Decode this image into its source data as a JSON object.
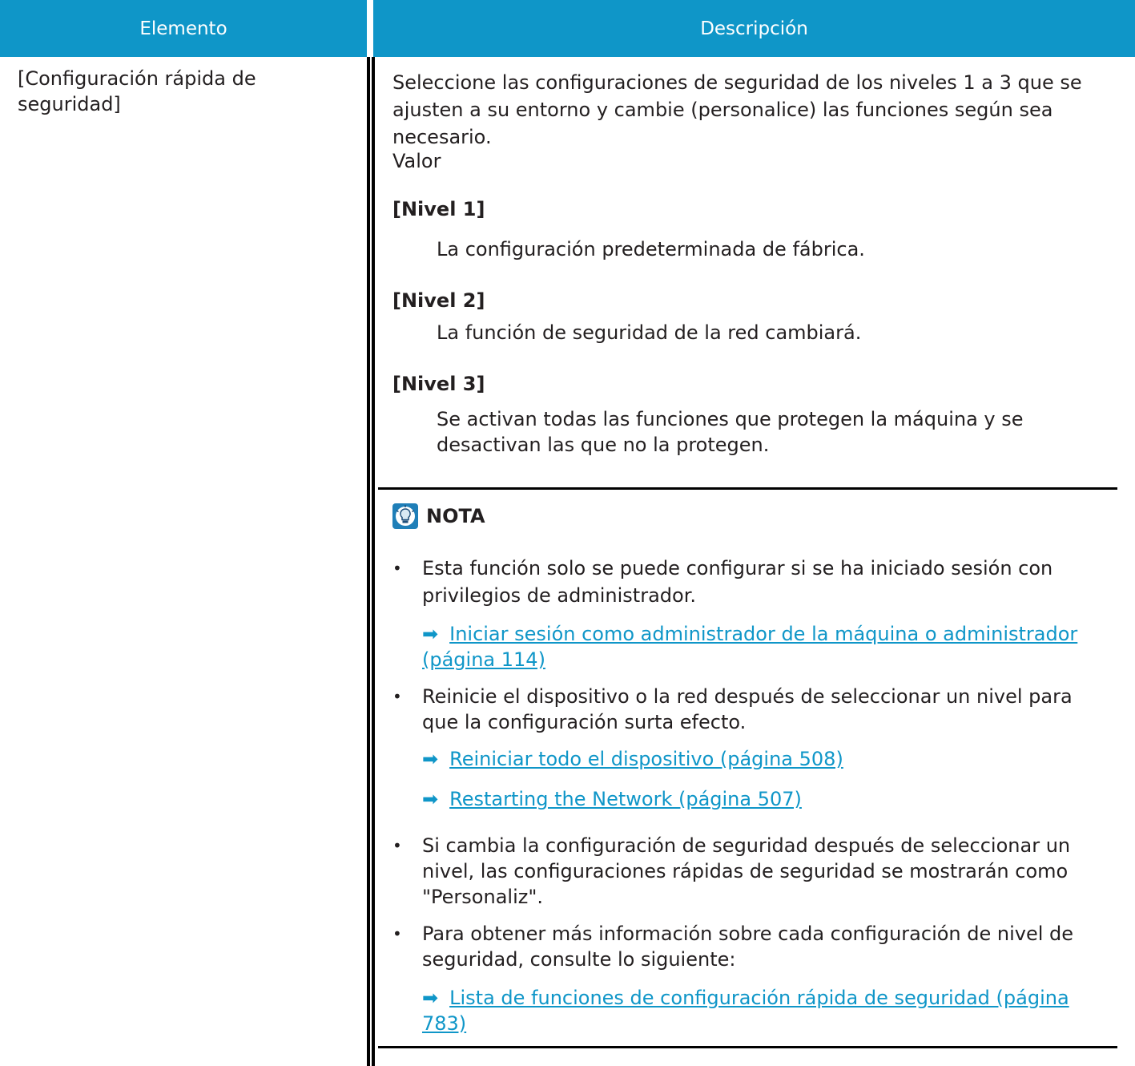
{
  "header": {
    "col1": "Elemento",
    "col2": "Descripción"
  },
  "item": {
    "line1": "[Configuración rápida de",
    "line2": "seguridad]"
  },
  "description": {
    "intro1": "Seleccione las configuraciones de seguridad de los niveles 1 a 3 que se",
    "intro2": "ajusten a su entorno y cambie (personalice) las funciones según sea",
    "intro3": "necesario.",
    "value_label": "Valor",
    "levels": [
      {
        "name": "[Nivel 1]",
        "desc1": "La configuración predeterminada de fábrica."
      },
      {
        "name": "[Nivel 2]",
        "desc1": "La función de seguridad de la red cambiará."
      },
      {
        "name": "[Nivel 3]",
        "desc1": "Se activan todas las funciones que protegen la máquina y se",
        "desc2": "desactivan las que no la protegen."
      }
    ]
  },
  "note": {
    "title": "NOTA",
    "icon": "lightbulb-icon",
    "bullets": [
      {
        "line1": "Esta función solo se puede configurar si se ha iniciado sesión con",
        "line2": "privilegios de administrador."
      },
      {
        "line1": "Reinicie el dispositivo o la red después de seleccionar un nivel para",
        "line2": "que la configuración surta efecto."
      },
      {
        "line1": "Si cambia la configuración de seguridad después de seleccionar un",
        "line2": "nivel, las configuraciones rápidas de seguridad se mostrarán como",
        "line3": "\"Personaliz\"."
      },
      {
        "line1": "Para obtener más información sobre cada configuración de nivel de",
        "line2": "seguridad, consulte lo siguiente:"
      }
    ],
    "links": {
      "admin_login1": "Iniciar sesión como administrador de la máquina o administrador",
      "admin_login2": "(página 114)",
      "restart_device": "Reiniciar todo el dispositivo (página 508)",
      "restart_network": "Restarting the Network (página 507)",
      "quick_list1": "Lista de funciones de configuración rápida de seguridad (página",
      "quick_list2": "783)"
    }
  },
  "colors": {
    "header_bg": "#0f96c8",
    "link": "#0f96c8",
    "text": "#231f20"
  }
}
